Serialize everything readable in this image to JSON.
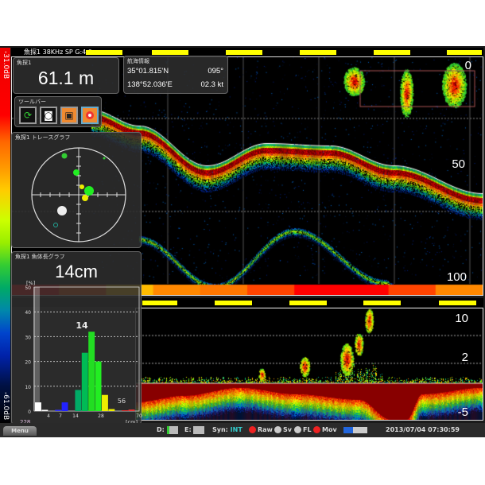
{
  "scale": {
    "top_label": "-31.0dB",
    "bottom_label": "-61.0dB"
  },
  "upper": {
    "header": "魚探1  38KHz SP   G:4.0",
    "depth_labels": [
      "0",
      "50",
      "100"
    ]
  },
  "lower": {
    "header": "魚探1  38KHz SP   G:4.0",
    "depth_labels": [
      "10",
      "2",
      "-5"
    ]
  },
  "depth_panel": {
    "title": "魚探1",
    "value": "61.1 m"
  },
  "nav_panel": {
    "title": "航海情報",
    "lat": "35°01.815'N",
    "lon": "138°52.036'E",
    "heading": "095°",
    "speed": "02.3 kt"
  },
  "toolbar": {
    "title": "ツールバー",
    "buttons": [
      {
        "icon": "refresh-icon"
      },
      {
        "icon": "camera-icon"
      },
      {
        "icon": "video-camera-icon"
      },
      {
        "icon": "record-icon"
      }
    ]
  },
  "trace_panel": {
    "title": "魚探1 トレースグラフ"
  },
  "length_panel": {
    "title": "魚探1 魚体長グラフ",
    "value": "14cm",
    "y_unit": "[%]",
    "x_unit": "[cm]",
    "count": "228",
    "peak_label": "14",
    "max_label": "56"
  },
  "chart_data": {
    "type": "bar",
    "ylabel": "[%]",
    "xlabel": "[cm]",
    "ylim": [
      0,
      50
    ],
    "y_ticks": [
      "0",
      "10",
      "20",
      "30",
      "40",
      "50"
    ],
    "x_ticks": [
      "4",
      "7",
      "14",
      "28",
      "70"
    ],
    "values": [
      3.5,
      0.5,
      0,
      0.5,
      3.5,
      0,
      8.5,
      23.5,
      32,
      20,
      6.5,
      0.8,
      0,
      0.3,
      0.6
    ],
    "colors": [
      "#fff",
      "#fff",
      "#fff",
      "#33f",
      "#22f",
      "#0a6",
      "#0a6",
      "#0b5",
      "#2d2",
      "#2e2",
      "#ee0",
      "#ee0",
      "#ee0",
      "#e33",
      "#e33"
    ]
  },
  "status": {
    "menu": "Menu",
    "d_label": "D:",
    "e_label": "E:",
    "syn_label": "Syn:",
    "syn_value": "INT",
    "raw": "Raw",
    "sv": "Sv",
    "fl": "FL",
    "mov": "Mov",
    "datetime": "2013/07/04  07:30:59"
  },
  "colors": {
    "accent_yellow": "#ffff00",
    "syn": "#3cc",
    "record_orange": "#f08a30"
  }
}
